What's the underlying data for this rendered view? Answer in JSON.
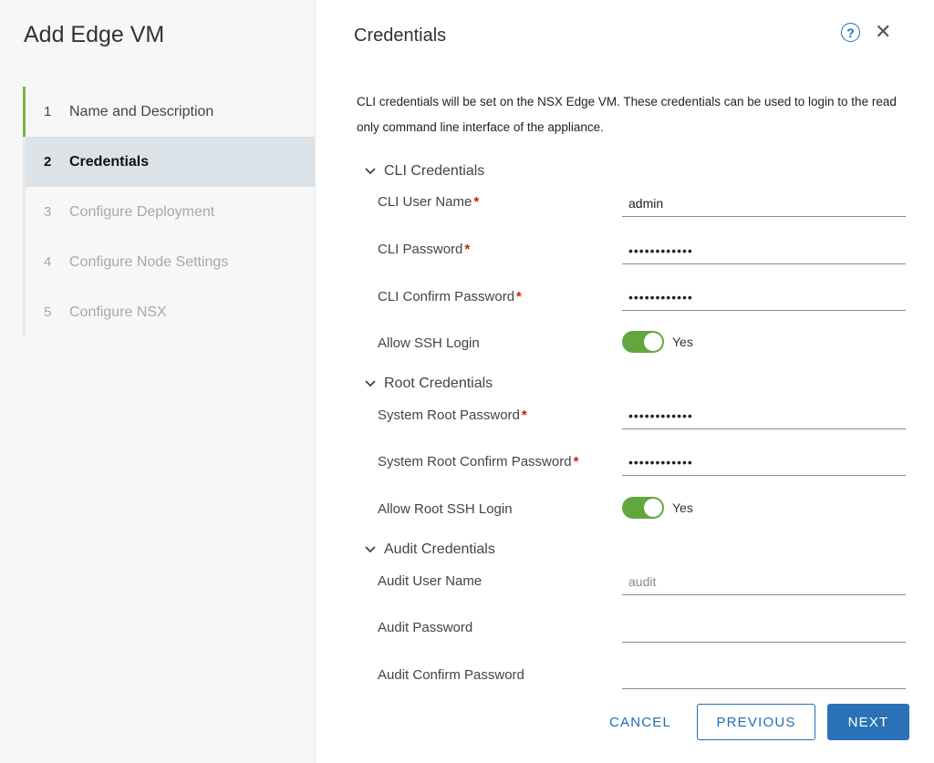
{
  "wizard": {
    "title": "Add Edge VM",
    "steps": [
      {
        "num": "1",
        "label": "Name and Description",
        "state": "done"
      },
      {
        "num": "2",
        "label": "Credentials",
        "state": "active"
      },
      {
        "num": "3",
        "label": "Configure Deployment",
        "state": "disabled"
      },
      {
        "num": "4",
        "label": "Configure Node Settings",
        "state": "disabled"
      },
      {
        "num": "5",
        "label": "Configure NSX",
        "state": "disabled"
      }
    ]
  },
  "page": {
    "title": "Credentials",
    "help_icon": "?",
    "close_icon": "✕",
    "intro": "CLI credentials will be set on the NSX Edge VM. These credentials can be used to login to the read only command line interface of the appliance."
  },
  "cli": {
    "heading": "CLI Credentials",
    "user_label": "CLI User Name",
    "user_value": "admin",
    "password_label": "CLI Password",
    "password_value": "••••••••••••",
    "confirm_label": "CLI Confirm Password",
    "confirm_value": "••••••••••••",
    "ssh_label": "Allow SSH Login",
    "ssh_value": "Yes"
  },
  "root": {
    "heading": "Root Credentials",
    "password_label": "System Root Password",
    "password_value": "••••••••••••",
    "confirm_label": "System Root Confirm Password",
    "confirm_value": "••••••••••••",
    "ssh_label": "Allow Root SSH Login",
    "ssh_value": "Yes"
  },
  "audit": {
    "heading": "Audit Credentials",
    "user_label": "Audit User Name",
    "user_placeholder": "audit",
    "password_label": "Audit Password",
    "confirm_label": "Audit Confirm Password"
  },
  "required_mark": "*",
  "buttons": {
    "cancel": "CANCEL",
    "previous": "PREVIOUS",
    "next": "NEXT"
  },
  "colors": {
    "accent": "#1e6fb5",
    "toggle_on": "#63a63d",
    "step_done": "#7cb342",
    "required": "#c92100"
  }
}
